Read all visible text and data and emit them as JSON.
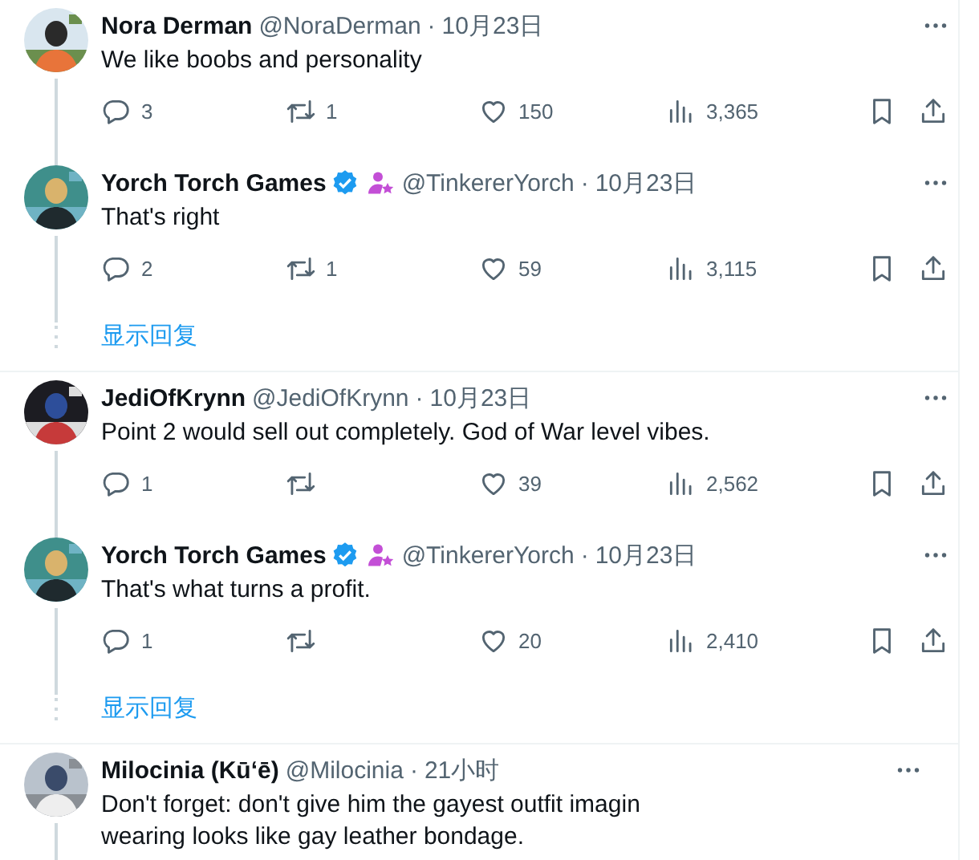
{
  "threads": [
    {
      "tweets": [
        {
          "name": "Nora Derman",
          "verified": false,
          "affiliate": false,
          "handle": "@NoraDerman",
          "dot": "·",
          "time": "10月23日",
          "lines": [
            "We like boobs and personality"
          ],
          "stats": {
            "replies": "3",
            "reposts": "1",
            "likes": "150",
            "views": "3,365"
          }
        },
        {
          "name": "Yorch Torch Games",
          "verified": true,
          "affiliate": true,
          "handle": "@TinkererYorch",
          "dot": "·",
          "time": "10月23日",
          "lines": [
            "That's right"
          ],
          "stats": {
            "replies": "2",
            "reposts": "1",
            "likes": "59",
            "views": "3,115"
          }
        }
      ],
      "show_replies": "显示回复"
    },
    {
      "tweets": [
        {
          "name": "JediOfKrynn",
          "verified": false,
          "affiliate": false,
          "handle": "@JediOfKrynn",
          "dot": "·",
          "time": "10月23日",
          "lines": [
            "Point 2 would sell out completely. God of War level vibes."
          ],
          "stats": {
            "replies": "1",
            "likes": "39",
            "views": "2,562"
          }
        },
        {
          "name": "Yorch Torch Games",
          "verified": true,
          "affiliate": true,
          "handle": "@TinkererYorch",
          "dot": "·",
          "time": "10月23日",
          "lines": [
            "That's what turns a profit."
          ],
          "stats": {
            "replies": "1",
            "likes": "20",
            "views": "2,410"
          }
        }
      ],
      "show_replies": "显示回复"
    },
    {
      "tweets": [
        {
          "name": "Milocinia (Kū‘ē)",
          "verified": false,
          "affiliate": false,
          "handle": "@Milocinia",
          "dot": "·",
          "time": "21小时",
          "lines": [
            "Don't forget: don't give him the gayest outfit imagin",
            "wearing looks like gay leather bondage."
          ]
        }
      ]
    }
  ]
}
